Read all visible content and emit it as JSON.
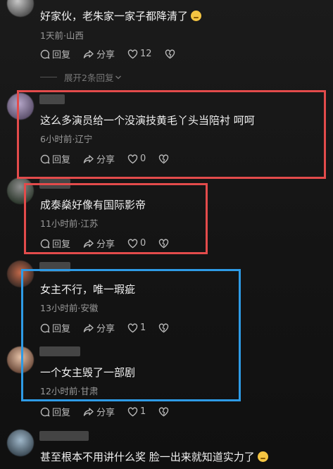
{
  "colors": {
    "highlight_red": "#e34b4b",
    "highlight_blue": "#2e9be6",
    "background": "#141414"
  },
  "actions": {
    "reply": "回复",
    "share": "分享"
  },
  "comments": [
    {
      "content": "好家伙，老朱家一家子都降清了",
      "meta": "1天前·山西",
      "likes": "12",
      "expand": "展开2条回复"
    },
    {
      "content": "这么多演员给一个没演技黄毛丫头当陪衬 呵呵",
      "meta": "6小时前·辽宁",
      "likes": "0"
    },
    {
      "content": "成泰燊好像有国际影帝",
      "meta": "11小时前·江苏",
      "likes": "0"
    },
    {
      "content": "女主不行，唯一瑕疵",
      "meta": "13小时前·安徽",
      "likes": "1"
    },
    {
      "content": "一个女主毁了一部剧",
      "meta": "12小时前·甘肃",
      "likes": "1"
    },
    {
      "content": "甚至根本不用讲什么奖 脸一出来就知道实力了"
    }
  ],
  "icons": [
    "reply-icon",
    "share-icon",
    "heart-icon",
    "dislike-heart-icon",
    "chevron-down-icon",
    "emoji-icon"
  ]
}
